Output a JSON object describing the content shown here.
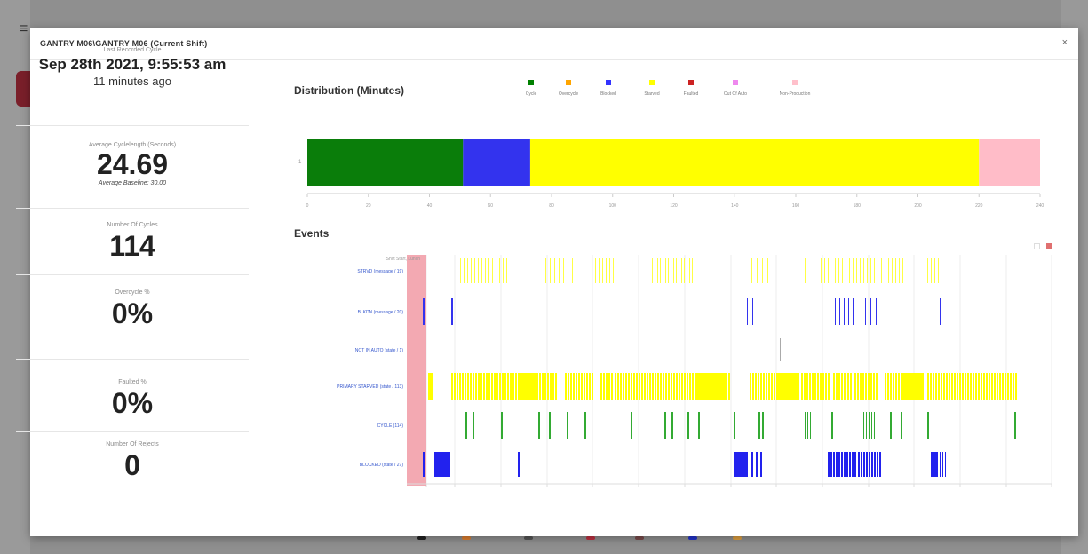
{
  "modal": {
    "title": "GANTRY M06\\GANTRY M06 (Current Shift)",
    "close_label": "×"
  },
  "stats": {
    "last_cycle": {
      "label": "Last Recorded Cycle",
      "date": "Sep 28th 2021, 9:55:53 am",
      "ago": "11 minutes ago"
    },
    "avg_cycle": {
      "label": "Average Cyclelength (Seconds)",
      "value": "24.69",
      "baseline": "Average Baseline: 30.00"
    },
    "num_cycles": {
      "label": "Number Of Cycles",
      "value": "114"
    },
    "overcycle": {
      "label": "Overcycle %",
      "value": "0%"
    },
    "faulted": {
      "label": "Faulted %",
      "value": "0%"
    },
    "rejects": {
      "label": "Number Of Rejects",
      "value": "0"
    }
  },
  "distribution": {
    "title": "Distribution (Minutes)",
    "legend": [
      {
        "name": "Cycle",
        "color": "#008000"
      },
      {
        "name": "Overcycle",
        "color": "#ffa500"
      },
      {
        "name": "Blocked",
        "color": "#3333ff"
      },
      {
        "name": "Starved",
        "color": "#ffff00"
      },
      {
        "name": "Faulted",
        "color": "#cc2222"
      },
      {
        "name": "Out Of Auto",
        "color": "#ee88ee"
      },
      {
        "name": "Non-Production",
        "color": "#ffc0cb"
      }
    ],
    "row_label": "1",
    "chart_data": {
      "type": "bar",
      "orientation": "horizontal-stacked",
      "segments": [
        {
          "name": "Cycle",
          "value": 51,
          "color": "#0a7d0a"
        },
        {
          "name": "Blocked",
          "value": 22,
          "color": "#3333ee"
        },
        {
          "name": "Starved",
          "value": 147,
          "color": "#ffff00"
        },
        {
          "name": "Non-Production",
          "value": 20,
          "color": "#ffbcc8"
        }
      ],
      "xlim": [
        0,
        240
      ],
      "xticks": [
        "0",
        "20",
        "40",
        "60",
        "80",
        "100",
        "120",
        "140",
        "160",
        "180",
        "200",
        "220",
        "240"
      ]
    }
  },
  "events": {
    "title": "Events",
    "shift_label": "Shift Start, Lunch",
    "rows": [
      {
        "label": "STRVD (message / 19)",
        "color": "#ffff44"
      },
      {
        "label": "BLKDN (message / 20)",
        "color": "#3333ee"
      },
      {
        "label": "NOT IN AUTO (state / 1)",
        "color": "#aaaaaa"
      },
      {
        "label": "PRIMARY STARVED (state / 113)",
        "color": "#ffff00"
      },
      {
        "label": "CYCLE (114)",
        "color": "#33aa33"
      },
      {
        "label": "BLOCKED (state / 27)",
        "color": "#2222ee"
      }
    ],
    "mini_icon_colors": [
      "#ffffff",
      "#e07070"
    ]
  }
}
